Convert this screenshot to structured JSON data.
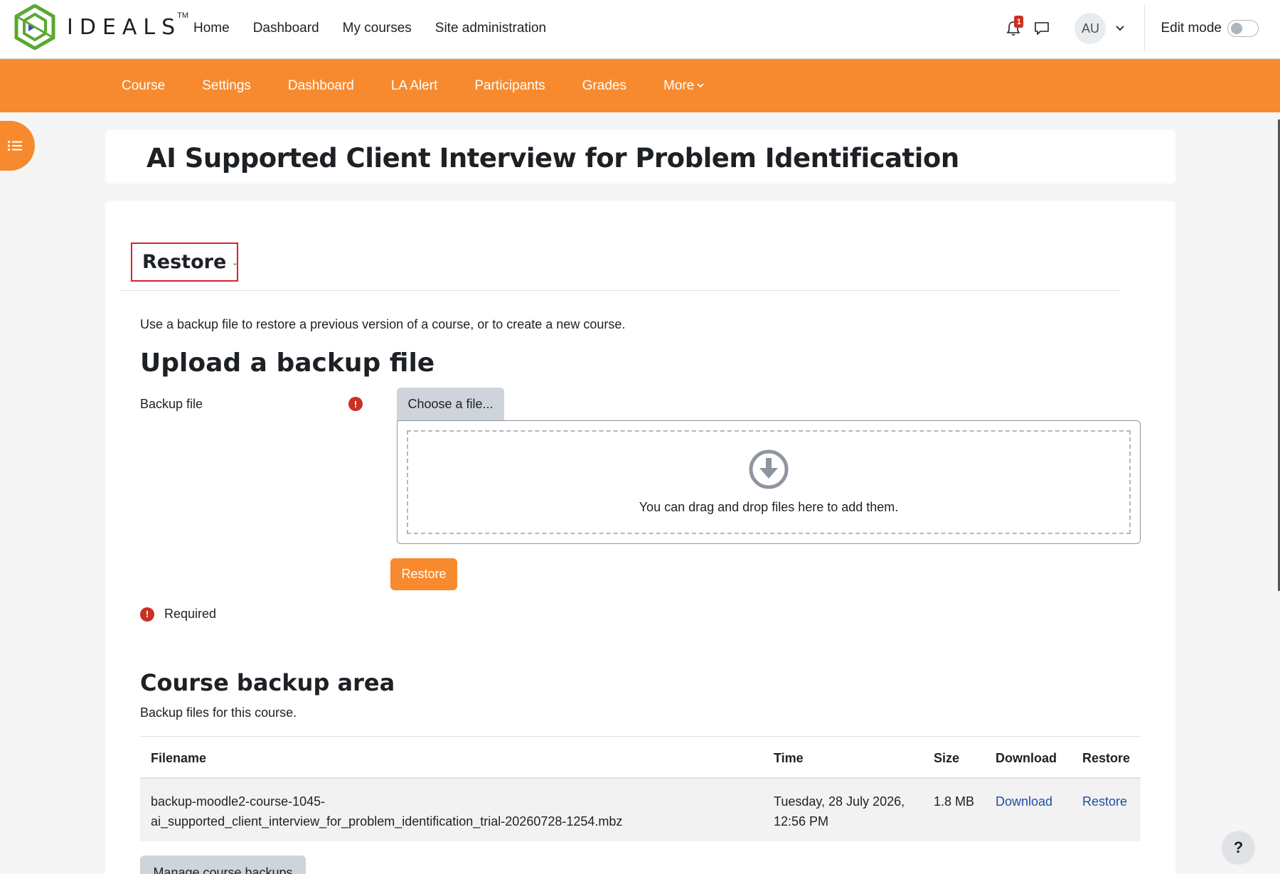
{
  "brand": {
    "name": "IDEALS",
    "tm": "TM"
  },
  "primary_nav": [
    "Home",
    "Dashboard",
    "My courses",
    "Site administration"
  ],
  "notifications": {
    "count": "1"
  },
  "user": {
    "initials": "AU"
  },
  "edit_mode": {
    "label": "Edit mode"
  },
  "secondary_nav": [
    "Course",
    "Settings",
    "Dashboard",
    "LA Alert",
    "Participants",
    "Grades",
    "More"
  ],
  "page": {
    "title": "AI Supported Client Interview for Problem Identification"
  },
  "restore_select": {
    "label": "Restore"
  },
  "intro": "Use a backup file to restore a previous version of a course, or to create a new course.",
  "upload": {
    "heading": "Upload a backup file",
    "field_label": "Backup file",
    "choose_label": "Choose a file...",
    "dropzone_text": "You can drag and drop files here to add them.",
    "restore_button": "Restore",
    "required_label": "Required"
  },
  "backup_area": {
    "heading": "Course backup area",
    "description": "Backup files for this course.",
    "columns": [
      "Filename",
      "Time",
      "Size",
      "Download",
      "Restore"
    ],
    "rows": [
      {
        "filename_line1": "backup-moodle2-course-1045-",
        "filename_line2": "ai_supported_client_interview_for_problem_identification_trial-20260728-1254.mbz",
        "time_line1": "Tuesday, 28 July 2026,",
        "time_line2": "12:56 PM",
        "size": "1.8 MB",
        "download": "Download",
        "restore": "Restore"
      }
    ],
    "manage_button": "Manage course backups"
  },
  "help": {
    "label": "?"
  },
  "colors": {
    "accent": "#f78a2e",
    "error": "#ca3120",
    "link": "#1f4ea5",
    "highlight": "#e0202a"
  }
}
